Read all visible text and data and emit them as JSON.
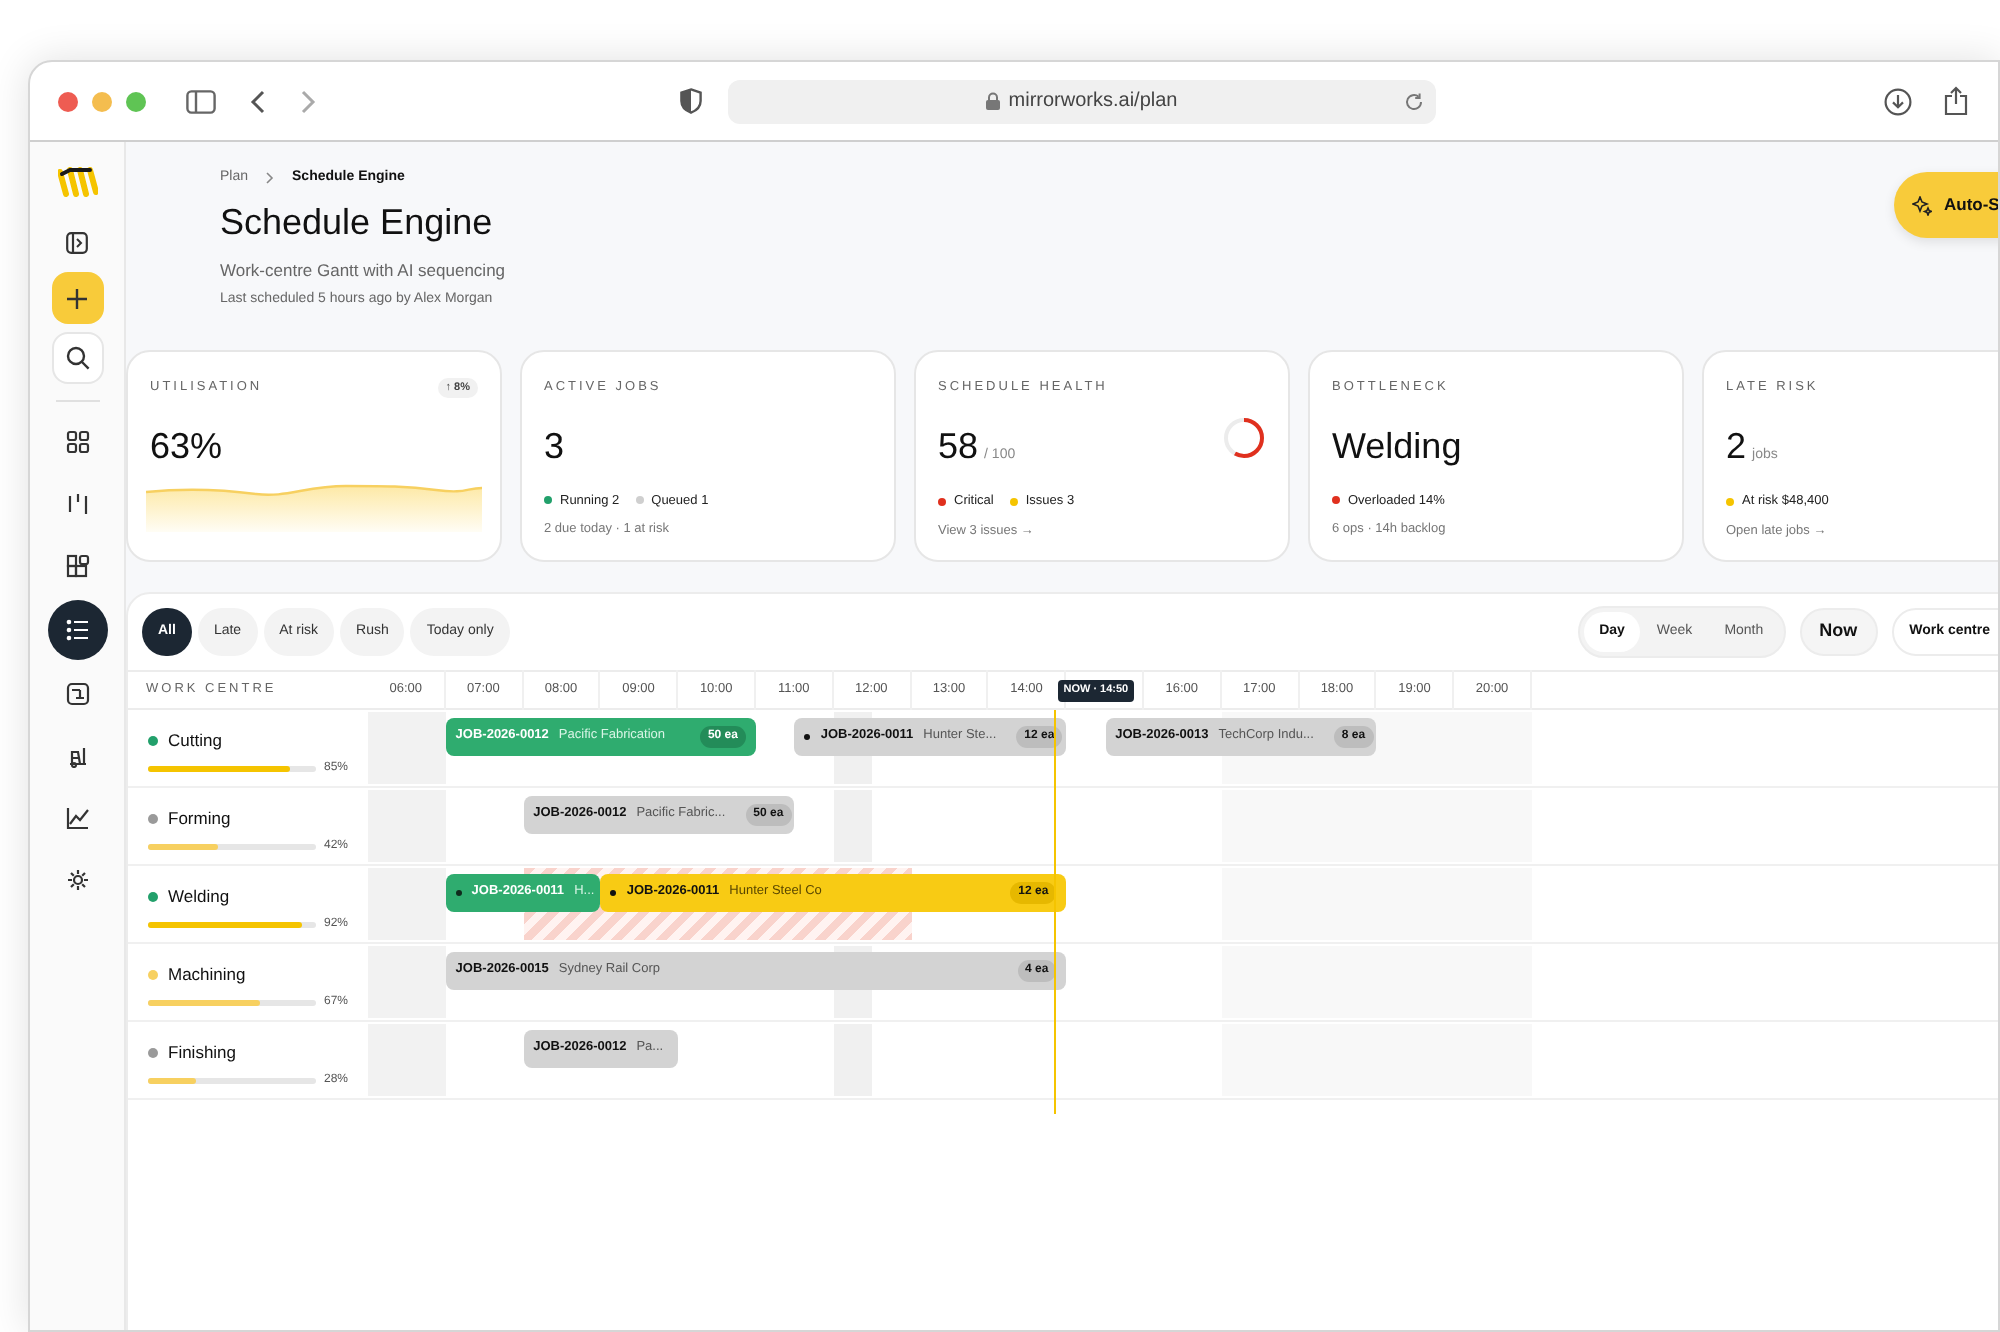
{
  "browser": {
    "url": "mirrorworks.ai/plan"
  },
  "sidebar": {
    "items": [
      {
        "selected": false
      },
      {
        "selected": false
      },
      {
        "selected": false
      },
      {
        "selected": true
      },
      {
        "selected": false
      },
      {
        "selected": false
      },
      {
        "selected": false
      },
      {
        "selected": false
      }
    ]
  },
  "breadcrumb": [
    "Plan",
    "Schedule Engine"
  ],
  "header": {
    "title": "Schedule Engine",
    "subtitle": "Work-centre Gantt with AI sequencing",
    "meta": "Last scheduled 5 hours ago by Alex Morgan",
    "action": "Auto-S"
  },
  "kpis": [
    {
      "kind": "spark",
      "label": "UTILISATION",
      "badge": "↑ 8%",
      "value": "63%"
    },
    {
      "kind": "plain",
      "label": "ACTIVE JOBS",
      "value": "3",
      "legend": [
        {
          "text": "Running 2",
          "color": "#22a06b"
        },
        {
          "text": "Queued 1",
          "color": "#cfcfcf"
        }
      ],
      "note": "2 due today · 1 at risk"
    },
    {
      "kind": "ring",
      "label": "SCHEDULE HEALTH",
      "value": "58",
      "unit": "/ 100",
      "level": 0.58,
      "legend": [
        {
          "text": "Critical",
          "color": "#e0301e"
        },
        {
          "text": "Issues 3",
          "color": "#f5c400"
        }
      ],
      "note": "View 3 issues →"
    },
    {
      "kind": "plain",
      "label": "BOTTLENECK",
      "value": "Welding",
      "legend": [
        {
          "text": "Overloaded 14%",
          "color": "#e0301e"
        }
      ],
      "note": "6 ops · 14h backlog"
    },
    {
      "kind": "plain",
      "label": "LATE RISK",
      "value": "2",
      "unit": "jobs",
      "legend": [
        {
          "text": "At risk $48,400",
          "color": "#f5c400"
        }
      ],
      "note": "Open late jobs →"
    }
  ],
  "filters": [
    {
      "label": "All",
      "selected": true
    },
    {
      "label": "Late",
      "selected": false
    },
    {
      "label": "At risk",
      "selected": false
    },
    {
      "label": "Rush",
      "selected": false
    },
    {
      "label": "Today only",
      "selected": false
    }
  ],
  "views": [
    {
      "label": "Day",
      "selected": true
    },
    {
      "label": "Week",
      "selected": false
    },
    {
      "label": "Month",
      "selected": false
    }
  ],
  "now_button": "Now",
  "group_button": "Work centre",
  "gantt": {
    "column": "WORK CENTRE",
    "hours_before_now": [
      "06:00",
      "07:00",
      "08:00",
      "09:00",
      "10:00",
      "11:00",
      "12:00",
      "13:00",
      "14:00"
    ],
    "now": "NOW · 14:50",
    "hours_after_now": [
      "16:00",
      "17:00",
      "18:00",
      "19:00",
      "20:00"
    ],
    "rows": [
      {
        "name": "Cutting",
        "color": "#22a06b",
        "level": 0.85,
        "pct": "85%",
        "bars": [
          {
            "kind": "running",
            "dot": false,
            "job": "JOB-2026-0012",
            "client": "Pacific Fabrication",
            "qty": "50 ea"
          },
          {
            "kind": "queued",
            "dot": true,
            "job": "JOB-2026-0011",
            "client": "Hunter Ste...",
            "qty": "12 ea"
          },
          {
            "kind": "queued",
            "dot": false,
            "job": "JOB-2026-0013",
            "client": "TechCorp Indu...",
            "qty": "8 ea"
          }
        ]
      },
      {
        "name": "Forming",
        "color": "#9a9a9a",
        "level": 0.42,
        "pct": "42%",
        "bars": [
          {
            "kind": "queued",
            "dot": false,
            "job": "JOB-2026-0012",
            "client": "Pacific Fabric...",
            "qty": "50 ea"
          }
        ]
      },
      {
        "name": "Welding",
        "color": "#22a06b",
        "level": 0.92,
        "pct": "92%",
        "conflict": true,
        "bars": [
          {
            "kind": "running",
            "dot": true,
            "job": "JOB-2026-0011",
            "client": "H..."
          },
          {
            "kind": "late",
            "dot": true,
            "job": "JOB-2026-0011",
            "client": "Hunter Steel Co",
            "qty": "12 ea"
          }
        ]
      },
      {
        "name": "Machining",
        "color": "#f7d060",
        "level": 0.67,
        "pct": "67%",
        "bars": [
          {
            "kind": "queued",
            "dot": false,
            "job": "JOB-2026-0015",
            "client": "Sydney Rail Corp",
            "qty": "4 ea"
          }
        ]
      },
      {
        "name": "Finishing",
        "color": "#9a9a9a",
        "level": 0.28,
        "pct": "28%",
        "bars": [
          {
            "kind": "queued",
            "dot": false,
            "job": "JOB-2026-0012",
            "client": "Pa..."
          }
        ]
      }
    ]
  }
}
